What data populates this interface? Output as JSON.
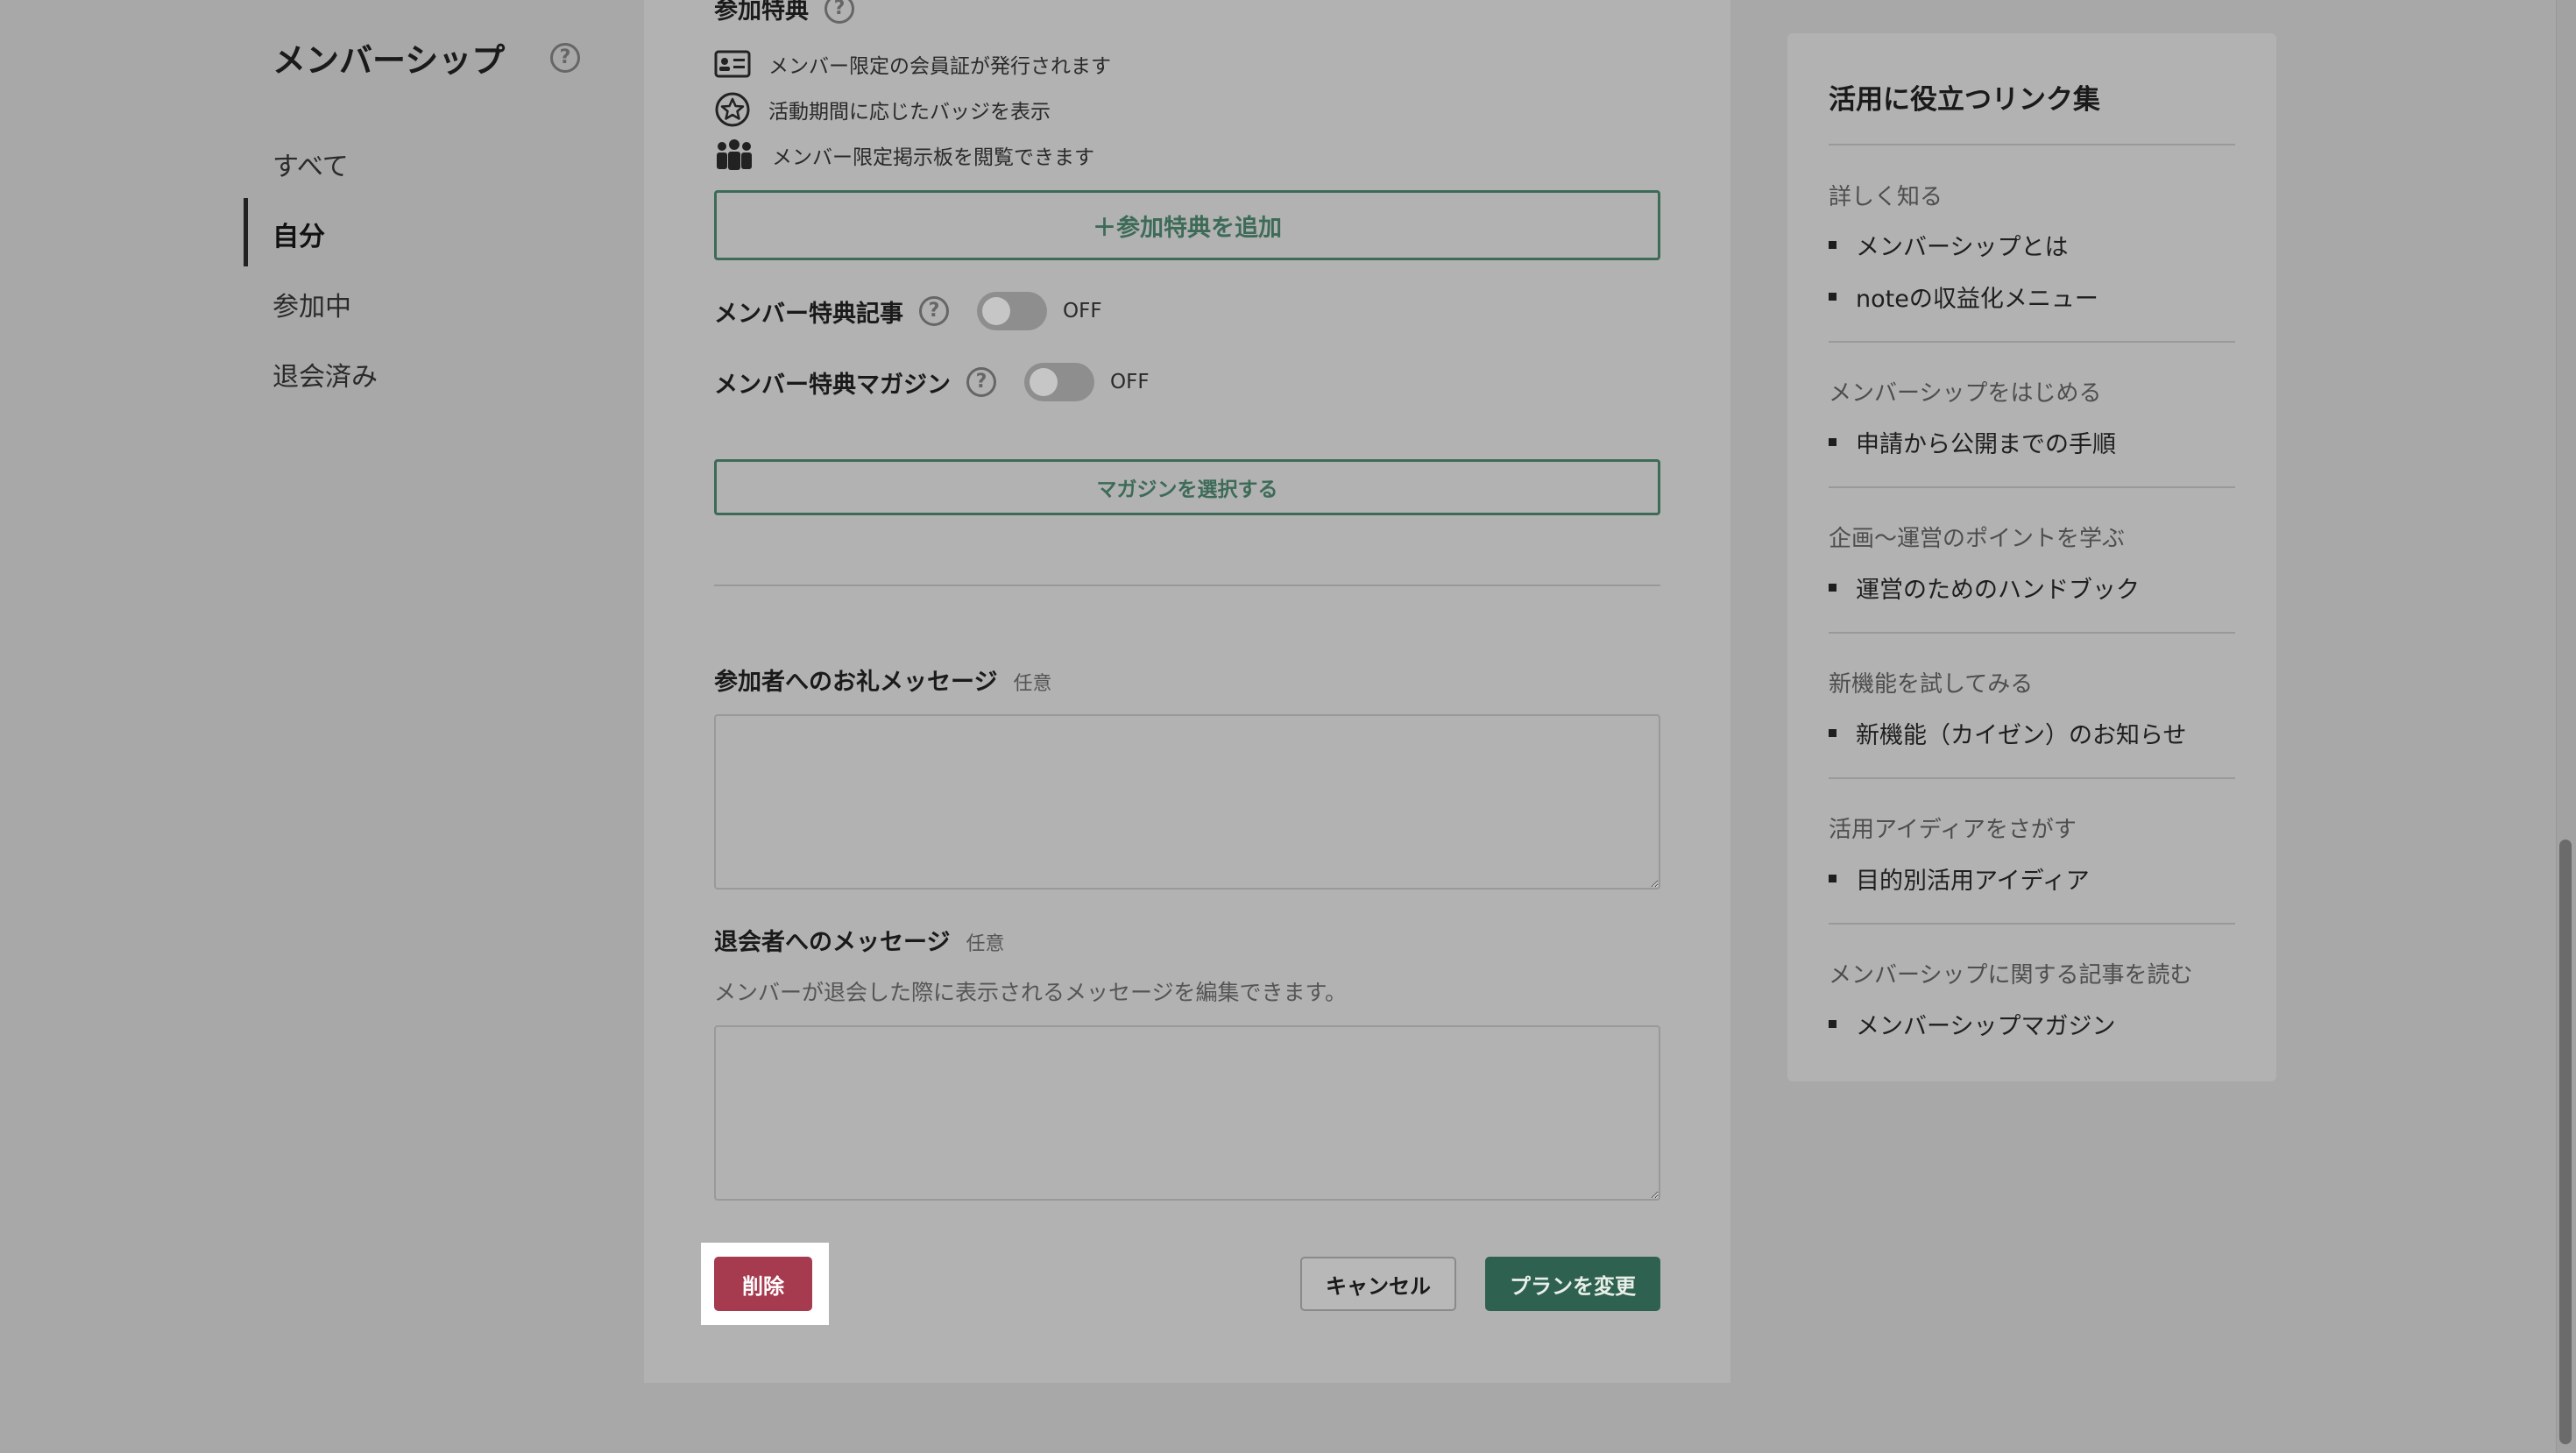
{
  "nav": {
    "title": "メンバーシップ",
    "items": [
      {
        "label": "すべて",
        "active": false
      },
      {
        "label": "自分",
        "active": true
      },
      {
        "label": "参加中",
        "active": false
      },
      {
        "label": "退会済み",
        "active": false
      }
    ]
  },
  "perks": {
    "heading": "参加特典",
    "items": [
      {
        "icon": "id-card-icon",
        "text": "メンバー限定の会員証が発行されます"
      },
      {
        "icon": "star-badge-icon",
        "text": "活動期間に応じたバッジを表示"
      },
      {
        "icon": "group-icon",
        "text": "メンバー限定掲示板を閲覧できます"
      }
    ],
    "add_button": "＋参加特典を追加"
  },
  "toggles": {
    "articles": {
      "label": "メンバー特典記事",
      "state": "OFF"
    },
    "magazine": {
      "label": "メンバー特典マガジン",
      "state": "OFF"
    }
  },
  "magazine_button": "マガジンを選択する",
  "thanks_message": {
    "label": "参加者へのお礼メッセージ",
    "optional": "任意",
    "value": ""
  },
  "leave_message": {
    "label": "退会者へのメッセージ",
    "optional": "任意",
    "description": "メンバーが退会した際に表示されるメッセージを編集できます。",
    "value": ""
  },
  "actions": {
    "delete": "削除",
    "cancel": "キャンセル",
    "change": "プランを変更"
  },
  "sidebar": {
    "title": "活用に役立つリンク集",
    "sections": [
      {
        "category": "詳しく知る",
        "links": [
          "メンバーシップとは",
          "noteの収益化メニュー"
        ]
      },
      {
        "category": "メンバーシップをはじめる",
        "links": [
          "申請から公開までの手順"
        ]
      },
      {
        "category": "企画〜運営のポイントを学ぶ",
        "links": [
          "運営のためのハンドブック"
        ]
      },
      {
        "category": "新機能を試してみる",
        "links": [
          "新機能（カイゼン）のお知らせ"
        ]
      },
      {
        "category": "活用アイディアをさがす",
        "links": [
          "目的別活用アイディア"
        ]
      },
      {
        "category": "メンバーシップに関する記事を読む",
        "links": [
          "メンバーシップマガジン"
        ]
      }
    ]
  },
  "colors": {
    "accent_green": "#3d6b58",
    "primary_green": "#2f6150",
    "danger_red": "#a63a4e"
  }
}
